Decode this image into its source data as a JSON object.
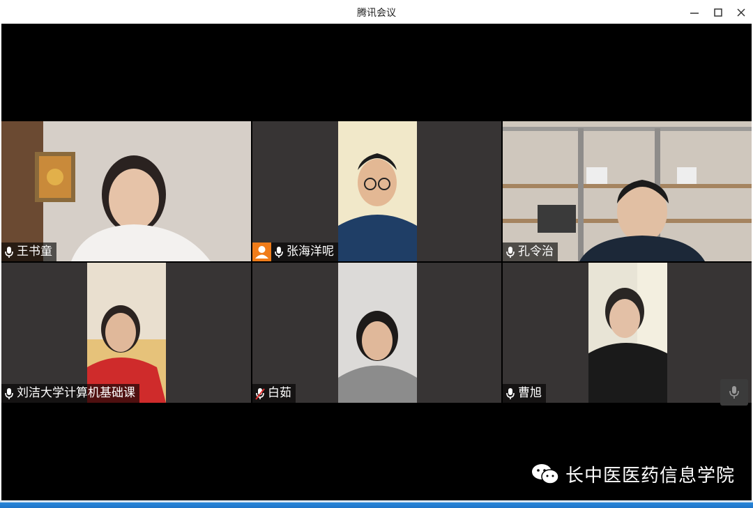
{
  "window": {
    "title": "腾讯会议",
    "controls": {
      "minimize_icon": "minimize-icon",
      "maximize_icon": "maximize-icon",
      "close_icon": "close-icon"
    }
  },
  "participants": [
    {
      "name": "王书童",
      "mic": "on",
      "active_speaker": true
    },
    {
      "name": "张海洋呢",
      "mic": "on",
      "avatar_badge": true
    },
    {
      "name": "孔令治",
      "mic": "on"
    },
    {
      "name": "刘洁大学计算机基础课",
      "mic": "on"
    },
    {
      "name": "白茹",
      "mic": "muted"
    },
    {
      "name": "曹旭",
      "mic": "on"
    }
  ],
  "watermark": {
    "text": "长中医医药信息学院",
    "icon": "wechat-icon"
  },
  "colors": {
    "active_border": "#1fc36a",
    "tile_bg": "#373434",
    "badge": "#f07c1a",
    "taskbar": "#1e74c8"
  }
}
